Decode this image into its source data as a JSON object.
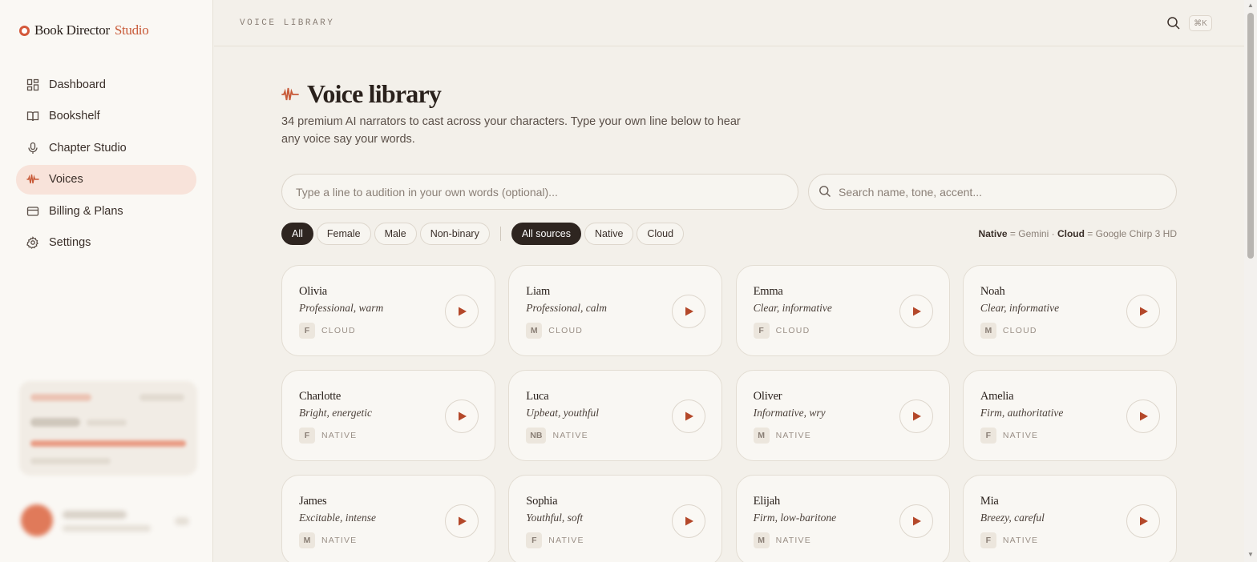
{
  "brand": {
    "name": "Book Director",
    "accent": "Studio"
  },
  "sidebar": {
    "items": [
      {
        "label": "Dashboard",
        "icon": "grid-icon",
        "active": false
      },
      {
        "label": "Bookshelf",
        "icon": "book-icon",
        "active": false
      },
      {
        "label": "Chapter Studio",
        "icon": "mic-icon",
        "active": false
      },
      {
        "label": "Voices",
        "icon": "waveform-icon",
        "active": true
      },
      {
        "label": "Billing & Plans",
        "icon": "card-icon",
        "active": false
      },
      {
        "label": "Settings",
        "icon": "gear-icon",
        "active": false
      }
    ]
  },
  "topbar": {
    "breadcrumb": "VOICE LIBRARY",
    "shortcut": "⌘K"
  },
  "page": {
    "title": "Voice library",
    "subtitle": "34 premium AI narrators to cast across your characters. Type your own line below to hear any voice say your words."
  },
  "audition": {
    "placeholder": "Type a line to audition in your own words (optional)..."
  },
  "search": {
    "placeholder": "Search name, tone, accent..."
  },
  "filters": {
    "gender": [
      {
        "label": "All",
        "on": true
      },
      {
        "label": "Female",
        "on": false
      },
      {
        "label": "Male",
        "on": false
      },
      {
        "label": "Non-binary",
        "on": false
      }
    ],
    "source": [
      {
        "label": "All sources",
        "on": true
      },
      {
        "label": "Native",
        "on": false
      },
      {
        "label": "Cloud",
        "on": false
      }
    ]
  },
  "legend": {
    "native": "Native",
    "native_desc": " = Gemini · ",
    "cloud": "Cloud",
    "cloud_desc": " = Google Chirp 3 HD"
  },
  "voices": [
    {
      "name": "Olivia",
      "tone": "Professional, warm",
      "gender": "F",
      "source": "CLOUD"
    },
    {
      "name": "Liam",
      "tone": "Professional, calm",
      "gender": "M",
      "source": "CLOUD"
    },
    {
      "name": "Emma",
      "tone": "Clear, informative",
      "gender": "F",
      "source": "CLOUD"
    },
    {
      "name": "Noah",
      "tone": "Clear, informative",
      "gender": "M",
      "source": "CLOUD"
    },
    {
      "name": "Charlotte",
      "tone": "Bright, energetic",
      "gender": "F",
      "source": "NATIVE"
    },
    {
      "name": "Luca",
      "tone": "Upbeat, youthful",
      "gender": "NB",
      "source": "NATIVE"
    },
    {
      "name": "Oliver",
      "tone": "Informative, wry",
      "gender": "M",
      "source": "NATIVE"
    },
    {
      "name": "Amelia",
      "tone": "Firm, authoritative",
      "gender": "F",
      "source": "NATIVE"
    },
    {
      "name": "James",
      "tone": "Excitable, intense",
      "gender": "M",
      "source": "NATIVE"
    },
    {
      "name": "Sophia",
      "tone": "Youthful, soft",
      "gender": "F",
      "source": "NATIVE"
    },
    {
      "name": "Elijah",
      "tone": "Firm, low-baritone",
      "gender": "M",
      "source": "NATIVE"
    },
    {
      "name": "Mia",
      "tone": "Breezy, careful",
      "gender": "F",
      "source": "NATIVE"
    }
  ],
  "colors": {
    "accent": "#c85a38",
    "active_bg": "#f8e3da",
    "chip_on": "#2e2520",
    "background": "#f3f0ea"
  }
}
